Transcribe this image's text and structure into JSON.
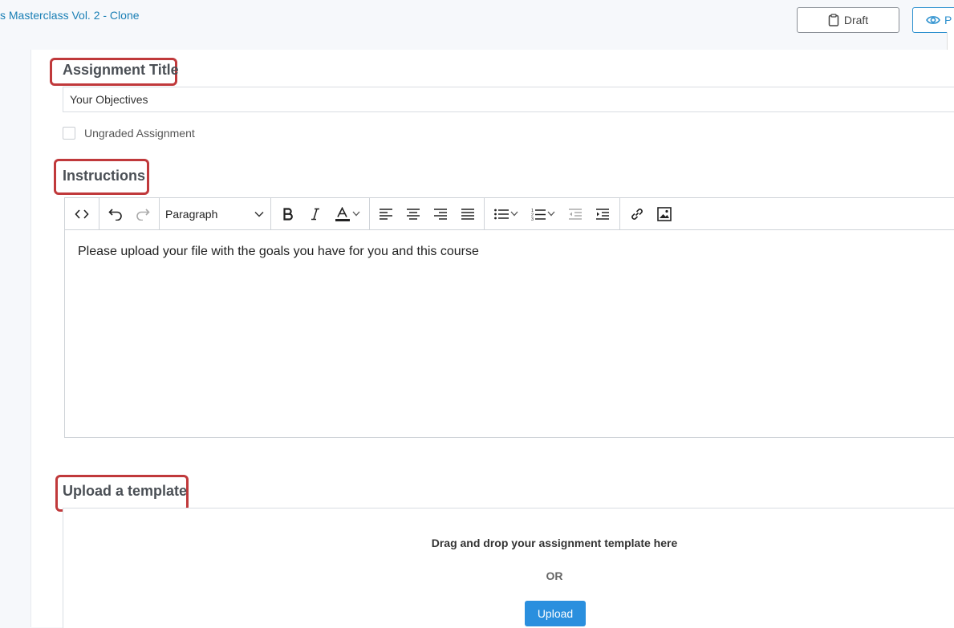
{
  "header": {
    "breadcrumb": "s Masterclass Vol. 2 - Clone",
    "draft_label": "Draft",
    "preview_label": "P"
  },
  "assignment": {
    "title_heading": "Assignment Title",
    "title_value": "Your Objectives",
    "ungraded_label": "Ungraded Assignment",
    "ungraded_checked": false
  },
  "instructions": {
    "heading": "Instructions",
    "block_format": "Paragraph",
    "body": "Please upload your file with the goals you have for you and this course",
    "toolbar_icons": [
      "code-icon",
      "undo-icon",
      "redo-icon",
      "bold-icon",
      "italic-icon",
      "text-color-icon",
      "align-left-icon",
      "align-center-icon",
      "align-right-icon",
      "align-justify-icon",
      "bullet-list-icon",
      "numbered-list-icon",
      "outdent-icon",
      "indent-icon",
      "link-icon",
      "image-icon"
    ]
  },
  "upload": {
    "heading": "Upload a template",
    "drop_text": "Drag and drop your assignment template here",
    "or_text": "OR",
    "button_label": "Upload"
  },
  "colors": {
    "accent": "#2a8fde",
    "highlight": "#c0393b",
    "link": "#1a7fb5"
  }
}
